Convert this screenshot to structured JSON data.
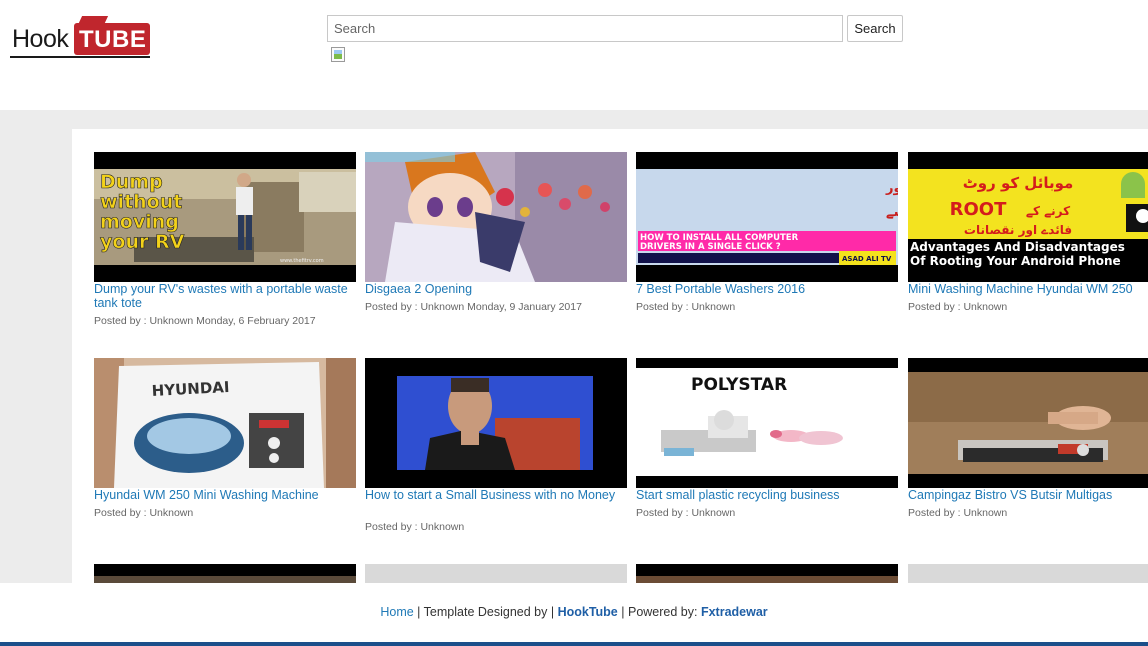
{
  "logo": {
    "hook": "Hook",
    "tube": "TUBE"
  },
  "search": {
    "placeholder": "Search",
    "button": "Search"
  },
  "videos": [
    {
      "title": "Dump your RV's wastes with a portable waste tank tote",
      "meta": "Posted by : Unknown Monday, 6 February 2017",
      "thumb_text": [
        "Dump",
        "without",
        "moving",
        "your RV"
      ]
    },
    {
      "title": "Disgaea 2 Opening",
      "meta": "Posted by : Unknown Monday, 9 January 2017"
    },
    {
      "title": "7 Best Portable Washers 2016",
      "meta": "Posted by : Unknown",
      "thumb_text": [
        "اپنے کمپیوٹر میں سارے ڈرائیور",
        "انسٹال کریں صرف ایک کلک سے",
        "HOW TO INSTALL ALL COMPUTER",
        "DRIVERS IN A SINGLE CLICK ?",
        "ASAD ALI TV"
      ]
    },
    {
      "title": "Mini Washing Machine Hyundai WM 250",
      "meta": "Posted by : Unknown",
      "thumb_text": [
        "موبائل کو روٹ",
        "ROOT",
        "کرنے کے",
        "فائدے اور نقصانات",
        "Advantages And Disadvantages",
        "Of Rooting Your Android Phone"
      ]
    },
    {
      "title": "Hyundai WM 250 Mini Washing Machine",
      "meta": "Posted by : Unknown",
      "thumb_text": [
        "HYUNDAI"
      ]
    },
    {
      "title": "How to start a Small Business with no Money",
      "meta": "Posted by : Unknown"
    },
    {
      "title": "Start small plastic recycling business",
      "meta": "Posted by : Unknown",
      "thumb_text": [
        "POLYSTAR"
      ]
    },
    {
      "title": "Campingaz Bistro VS Butsir Multigas",
      "meta": "Posted by : Unknown"
    }
  ],
  "footer": {
    "home": "Home",
    "designed": "Template Designed by",
    "brand": "HookTube",
    "powered": "Powered by:",
    "powered_name": "Fxtradewar"
  }
}
